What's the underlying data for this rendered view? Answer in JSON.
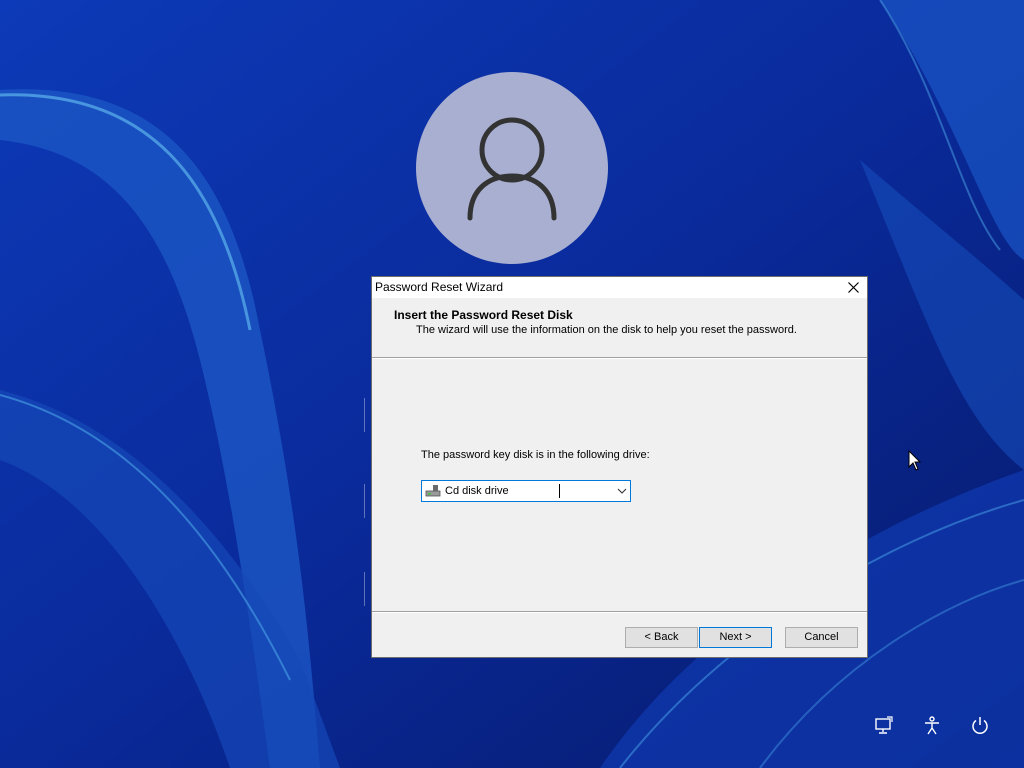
{
  "dialog": {
    "title": "Password Reset Wizard",
    "header_title": "Insert the Password Reset Disk",
    "header_subtitle": "The wizard will use the information on the disk to help you reset the password.",
    "prompt": "The password key disk is in the following drive:",
    "drive_select": {
      "value": "Cd disk drive",
      "icon": "drive-icon"
    },
    "buttons": {
      "back": "< Back",
      "next": "Next >",
      "cancel": "Cancel"
    }
  },
  "lockscreen": {
    "avatar_icon": "user-icon",
    "tray_icons": [
      "network-icon",
      "accessibility-icon",
      "power-icon"
    ]
  },
  "colors": {
    "accent": "#0078d7",
    "wallpaper": "#0a2a9c",
    "avatar": "#a8afd0"
  }
}
